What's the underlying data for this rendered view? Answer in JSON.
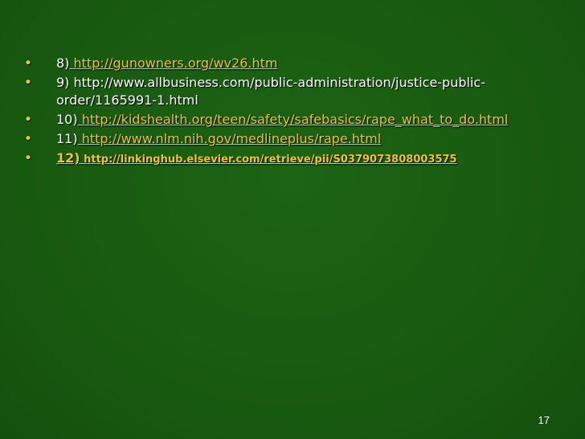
{
  "slide": {
    "references": [
      {
        "number": "8)",
        "text": " http://gunowners.org/wv26.htm",
        "is_link": true
      },
      {
        "number": "9)",
        "text": " http://www.allbusiness.com/public-administration/justice-public-order/1165991-1.html",
        "is_link": false
      },
      {
        "number": "10)",
        "text": " http://kidshealth.org/teen/safety/safebasics/rape_what_to_do.html",
        "is_link": true
      },
      {
        "number": "11)",
        "text": " http://www.nlm.nih.gov/medlineplus/rape.html",
        "is_link": true
      },
      {
        "number": "12)",
        "text": " http://linkinghub.elsevier.com/retrieve/pii/S0379073808003575",
        "is_link": true
      }
    ],
    "page_number": "17"
  },
  "colors": {
    "background": "#1a5c12",
    "bullet": "#f0c81e",
    "link": "#f0c81e",
    "text": "#ffffff"
  }
}
